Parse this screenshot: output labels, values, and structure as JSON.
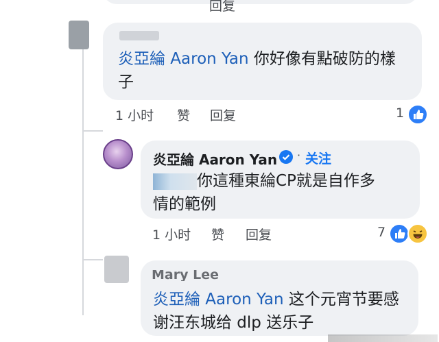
{
  "top_reply_button": {
    "label": "回复"
  },
  "comments": [
    {
      "tag_name": "炎亞綸 Aaron Yan",
      "text_line1": "你好像有點破防的樣",
      "text_line2": "子",
      "time": "1 小时",
      "like_label": "赞",
      "reply_label": "回复",
      "reaction_count": "1"
    },
    {
      "author": "炎亞綸 Aaron Yan",
      "follow_label": "关注",
      "text_line1": "你這種東綸CP就是自作多",
      "text_line2": "情的範例",
      "time": "1 小时",
      "like_label": "赞",
      "reply_label": "回复",
      "reaction_count": "7"
    },
    {
      "author": "Mary Lee",
      "tag_name": "炎亞綸 Aaron Yan",
      "text_line1": " 这个元宵节要感",
      "text_line2": "谢汪东城给 dlp 送乐子"
    }
  ],
  "colors": {
    "bubble": "#eff1f4",
    "link": "#1d5fb8",
    "like": "#2d7ef7",
    "haha": "#f7c440",
    "verified": "#1877f2"
  },
  "icons": [
    "like-icon",
    "haha-icon",
    "verified-badge-icon"
  ]
}
